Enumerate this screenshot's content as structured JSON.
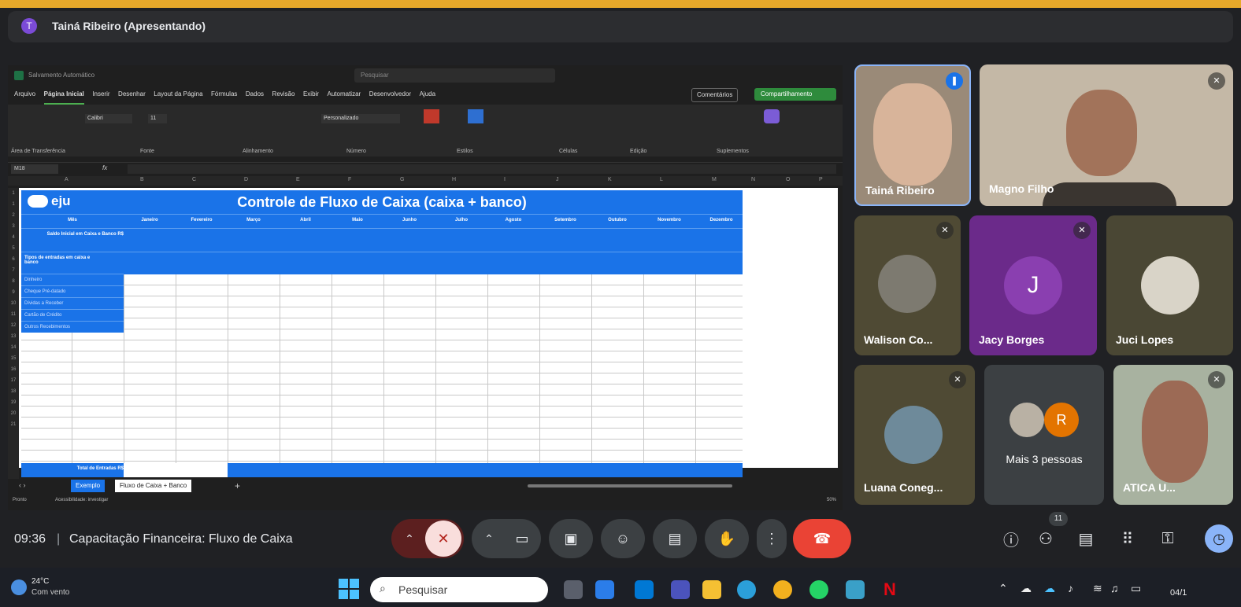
{
  "meet": {
    "presenter_banner": "Tainá Ribeiro (Apresentando)",
    "presenter_initial": "T",
    "time": "09:36",
    "separator": "|",
    "meeting_title": "Capacitação Financeira: Fluxo de Caixa",
    "participant_count": "11"
  },
  "excel": {
    "autosave": "Salvamento Automático",
    "search_placeholder": "Pesquisar",
    "menu": [
      "Arquivo",
      "Página Inicial",
      "Inserir",
      "Desenhar",
      "Layout da Página",
      "Fórmulas",
      "Dados",
      "Revisão",
      "Exibir",
      "Automatizar",
      "Desenvolvedor",
      "Ajuda"
    ],
    "comment_button": "Comentários",
    "share_button": "Compartilhamento",
    "ribbon_groups": [
      "Área de Transferência",
      "Fonte",
      "Alinhamento",
      "Número",
      "Estilos",
      "Células",
      "Edição",
      "Suplementos"
    ],
    "font_name": "Calibri",
    "font_size": "11",
    "number_format": "Personalizado",
    "name_box": "M18",
    "fx": "fx",
    "columns": [
      "A",
      "B",
      "C",
      "D",
      "E",
      "F",
      "G",
      "H",
      "I",
      "J",
      "K",
      "L",
      "M",
      "N",
      "O",
      "P"
    ],
    "logo_text": "eju",
    "sheet_title": "Controle de Fluxo de Caixa (caixa + banco)",
    "month_header": "Mês",
    "months": [
      "Janeiro",
      "Fevereiro",
      "Março",
      "Abril",
      "Maio",
      "Junho",
      "Julho",
      "Agosto",
      "Setembro",
      "Outubro",
      "Novembro",
      "Dezembro"
    ],
    "saldo_label": "Saldo Inicial em Caixa e Banco R$",
    "tipos_label": "Tipos de entradas em caixa e banco",
    "items": [
      "Dinheiro",
      "Cheque Pré-datado",
      "Dívidas a Receber",
      "Cartão de Crédito",
      "Outros Recebimentos"
    ],
    "total_label": "Total de Entradas R$",
    "tabs": {
      "exemplo": "Exemplo",
      "fluxo": "Fluxo de Caixa + Banco",
      "add": "+"
    },
    "status_ready": "Pronto",
    "status_accessibility": "Acessibilidade: investigar",
    "zoom": "50%"
  },
  "participants": [
    {
      "name": "Tainá Ribeiro"
    },
    {
      "name": "Magno Filho"
    },
    {
      "name": "Walison Co..."
    },
    {
      "name": "Jacy Borges",
      "initial": "J"
    },
    {
      "name": "Juci Lopes"
    },
    {
      "name": "Luana Coneg..."
    },
    {
      "name": "Mais 3 pessoas",
      "initial": "R"
    },
    {
      "name": "ATICA U..."
    }
  ],
  "taskbar": {
    "temperature": "24°C",
    "weather": "Com vento",
    "search_placeholder": "Pesquisar",
    "date": "04/1"
  },
  "colors": {
    "sheet_blue": "#1a73e8",
    "end_call": "#ea4335",
    "mic_muted_bg": "#f9dedc",
    "jacy_tile": "#6b2a8a",
    "background_yellow": "#e7a92a"
  }
}
